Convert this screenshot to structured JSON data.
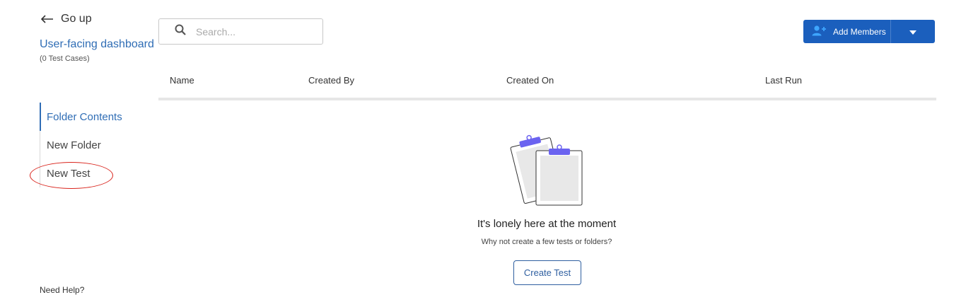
{
  "nav": {
    "go_up_label": "Go up",
    "project_title": "User-facing dashboard",
    "project_subtitle": "(0 Test Cases)",
    "side_items": [
      {
        "label": "Folder Contents"
      },
      {
        "label": "New Folder"
      },
      {
        "label": "New Test"
      }
    ],
    "help_label": "Need Help?"
  },
  "search": {
    "placeholder": "Search...",
    "value": ""
  },
  "toolbar": {
    "add_members_label": "Add Members"
  },
  "table": {
    "columns": [
      "Name",
      "Created By",
      "Created On",
      "Last Run"
    ]
  },
  "empty_state": {
    "title": "It's lonely here at the moment",
    "subtitle": "Why not create a few tests or folders?",
    "button_label": "Create Test"
  },
  "icons": {
    "back": "arrow-left-icon",
    "search": "search-icon",
    "add_members": "user-plus-icon",
    "dropdown": "caret-down-icon",
    "empty": "clipboard-illustration"
  },
  "colors": {
    "accent": "#2f6db5",
    "primary_button": "#1b5fbd",
    "annotation": "#d9241c",
    "illustration_clip": "#6b63f0"
  }
}
